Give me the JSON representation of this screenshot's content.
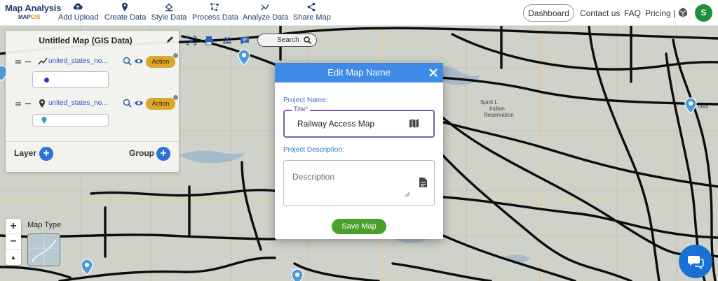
{
  "app": {
    "title": "Map Analysis",
    "sub_brand": "MAP",
    "sub_brand_accent": "GIS"
  },
  "nav": [
    {
      "label": "Add Upload",
      "icon": "cloud-upload-icon"
    },
    {
      "label": "Create Data",
      "icon": "map-pin-icon"
    },
    {
      "label": "Style Data",
      "icon": "paint-bucket-icon"
    },
    {
      "label": "Process Data",
      "icon": "polygon-icon"
    },
    {
      "label": "Analyze Data",
      "icon": "analytics-icon"
    },
    {
      "label": "Share Map",
      "icon": "share-icon"
    }
  ],
  "header_right": {
    "dashboard": "Dashboard",
    "contact": "Contact us",
    "faq": "FAQ",
    "pricing": "Pricing |",
    "avatar_initial": "S"
  },
  "layer_panel": {
    "title": "Untitled Map (GIS Data)",
    "layers": [
      {
        "name": "united_states_no...",
        "action": "Action",
        "type": "line",
        "legend_color": "#2a2fc8"
      },
      {
        "name": "united_states_no...",
        "action": "Action",
        "type": "point",
        "legend_color": "#3aa0d0"
      }
    ],
    "layer_label": "Layer",
    "group_label": "Group"
  },
  "toolbar": {
    "search_label": "Search"
  },
  "map_controls": {
    "zoom_in": "+",
    "zoom_out": "−",
    "map_type_label": "Map Type"
  },
  "map_labels": {
    "spirit_lake": "Spirit L",
    "indian": "Indian",
    "reservation": "Reservation",
    "works": "orks"
  },
  "modal": {
    "title": "Edit Map Name",
    "project_name_label": "Project Name:",
    "title_field_label": "Title*",
    "title_value": "Railway Access Map",
    "project_description_label": "Project Description:",
    "description_placeholder": "Description",
    "save_label": "Save Map"
  },
  "colors": {
    "accent_blue": "#3d8be6",
    "action_gold": "#d9a72b",
    "save_green": "#4aa02a",
    "avatar_green": "#1f8f3e"
  }
}
